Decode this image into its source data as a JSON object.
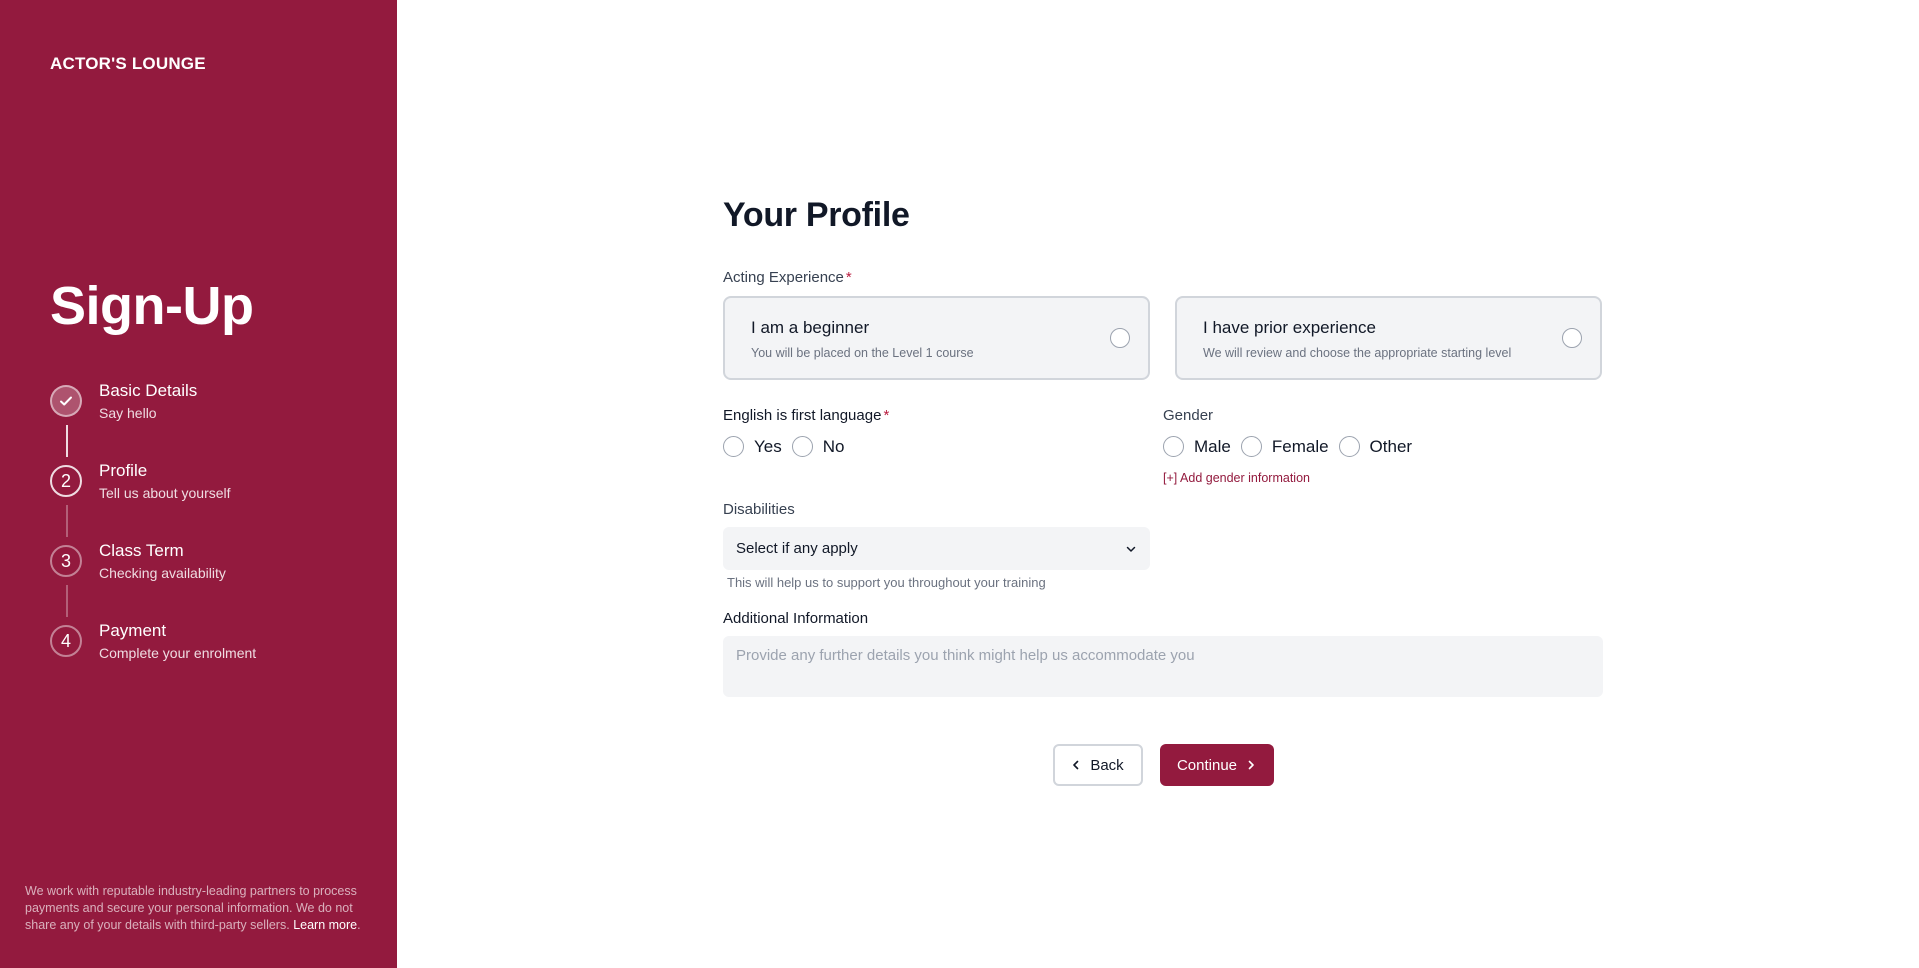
{
  "sidebar": {
    "brand": "ACTOR'S LOUNGE",
    "title": "Sign-Up",
    "steps": [
      {
        "marker": "",
        "title": "Basic Details",
        "subtitle": "Say hello",
        "state": "complete"
      },
      {
        "marker": "2",
        "title": "Profile",
        "subtitle": "Tell us about yourself",
        "state": "current"
      },
      {
        "marker": "3",
        "title": "Class Term",
        "subtitle": "Checking availability",
        "state": "upcoming"
      },
      {
        "marker": "4",
        "title": "Payment",
        "subtitle": "Complete your enrolment",
        "state": "upcoming"
      }
    ],
    "footer_text": "We work with reputable industry-leading partners to process payments and secure your personal information. We do not share any of your details with third-party sellers.",
    "footer_link": "Learn more",
    "footer_end": "."
  },
  "form": {
    "title": "Your Profile",
    "experience": {
      "label": "Acting Experience",
      "required_mark": "*",
      "options": [
        {
          "title": "I am a beginner",
          "subtitle": "You will be placed on the Level 1 course"
        },
        {
          "title": "I have prior experience",
          "subtitle": "We will review and choose the appropriate starting level"
        }
      ]
    },
    "english": {
      "label": "English is first language",
      "required_mark": "*",
      "options": [
        "Yes",
        "No"
      ]
    },
    "gender": {
      "label": "Gender",
      "options": [
        "Male",
        "Female",
        "Other"
      ],
      "add_link": "[+] Add gender information"
    },
    "disabilities": {
      "label": "Disabilities",
      "selected": "Select if any apply",
      "help": "This will help us to support you throughout your training"
    },
    "additional": {
      "label": "Additional Information",
      "placeholder": "Provide any further details you think might help us accommodate you"
    },
    "back_label": "Back",
    "continue_label": "Continue"
  },
  "colors": {
    "brand": "#931a3e",
    "field_bg": "#f3f4f6"
  }
}
